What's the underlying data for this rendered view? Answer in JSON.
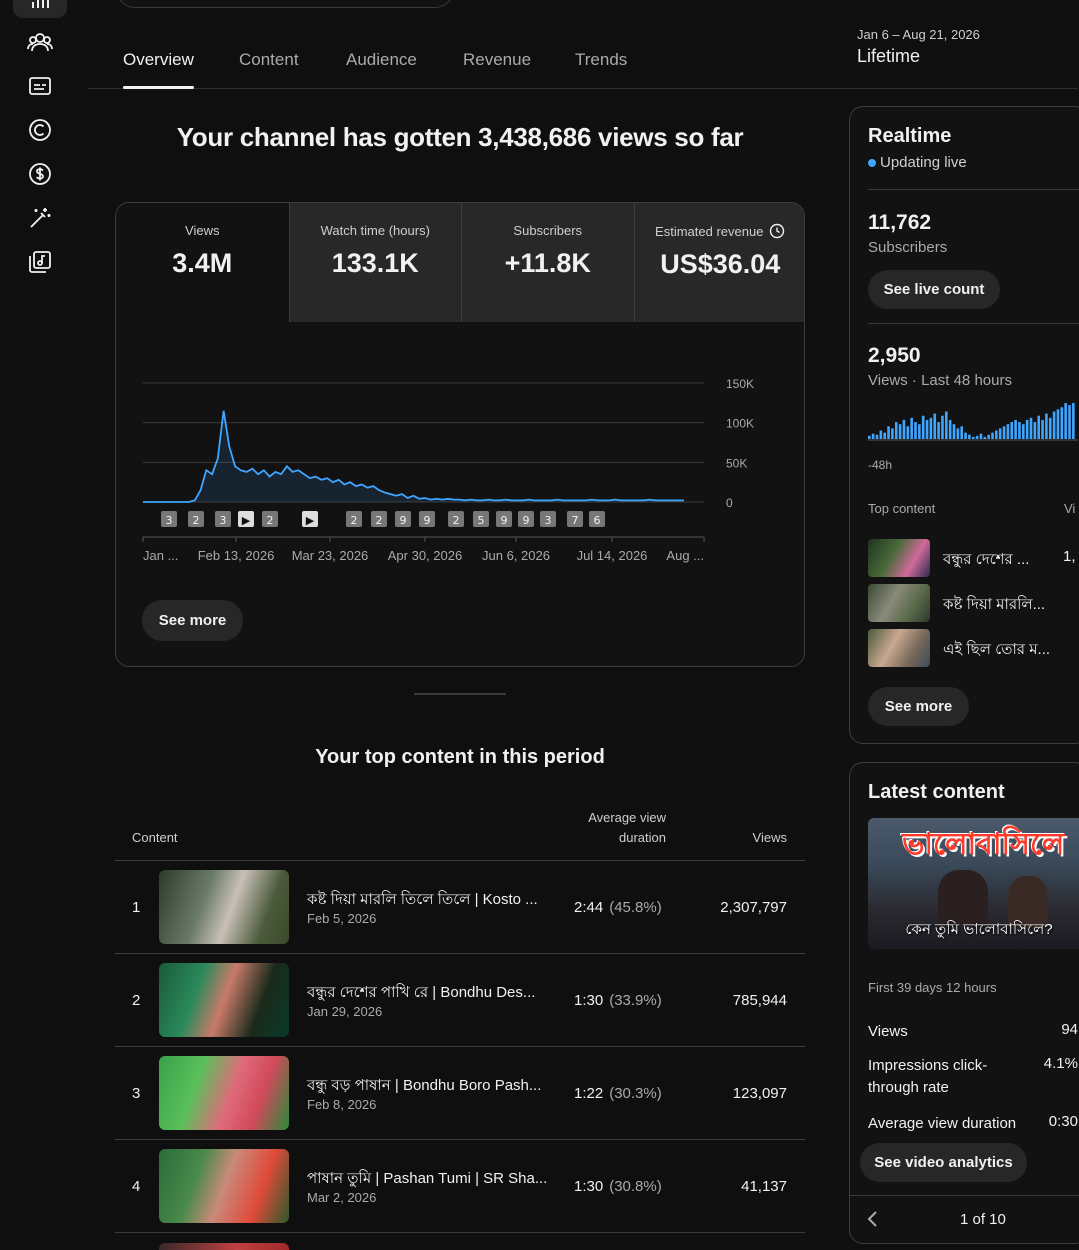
{
  "tabs": [
    {
      "label": "Overview"
    },
    {
      "label": "Content"
    },
    {
      "label": "Audience"
    },
    {
      "label": "Revenue"
    },
    {
      "label": "Trends"
    }
  ],
  "period": {
    "range": "Jan 6 – Aug 21, 2026",
    "label": "Lifetime"
  },
  "headline": "Your channel has gotten 3,438,686 views so far",
  "metrics": [
    {
      "label": "Views",
      "value": "3.4M"
    },
    {
      "label": "Watch time (hours)",
      "value": "133.1K"
    },
    {
      "label": "Subscribers",
      "value": "+11.8K"
    },
    {
      "label": "Estimated revenue",
      "value": "US$36.04"
    }
  ],
  "chart_data": {
    "type": "line",
    "series": [
      {
        "values": [
          0,
          0,
          0,
          0,
          0,
          0,
          0,
          0,
          0,
          2,
          15,
          40,
          35,
          55,
          115,
          70,
          45,
          40,
          38,
          42,
          35,
          40,
          32,
          38,
          35,
          45,
          38,
          40,
          35,
          30,
          32,
          28,
          30,
          25,
          28,
          22,
          25,
          20,
          22,
          18,
          20,
          15,
          12,
          10,
          8,
          10,
          5,
          8,
          4,
          5,
          3,
          4,
          3,
          4,
          3,
          3,
          2,
          3,
          2,
          2,
          3,
          2,
          2,
          3,
          2,
          2,
          2,
          3,
          2,
          2,
          2,
          2,
          3,
          2,
          2,
          2,
          2,
          2,
          3,
          2,
          2,
          2,
          3,
          2,
          2,
          2,
          2,
          2,
          3,
          2,
          2,
          2,
          2,
          2,
          2
        ]
      }
    ],
    "x_labels": [
      "Jan ...",
      "Feb 13, 2026",
      "Mar 23, 2026",
      "Apr 30, 2026",
      "Jun 6, 2026",
      "Jul 14, 2026",
      "Aug ..."
    ],
    "y_ticks": [
      "150K",
      "100K",
      "50K",
      "0"
    ],
    "ylim": [
      0,
      150000
    ],
    "markers": [
      {
        "label": "3"
      },
      {
        "label": "2"
      },
      {
        "label": "3"
      },
      {
        "label": "▶"
      },
      {
        "label": "2"
      },
      {
        "label": "▶"
      },
      {
        "label": "2"
      },
      {
        "label": "2"
      },
      {
        "label": "9"
      },
      {
        "label": "9"
      },
      {
        "label": "2"
      },
      {
        "label": "5"
      },
      {
        "label": "9"
      },
      {
        "label": "9"
      },
      {
        "label": "3"
      },
      {
        "label": "7"
      },
      {
        "label": "6"
      }
    ],
    "colors": {
      "line": "#3ea6ff",
      "grid": "#3a3a3a"
    }
  },
  "see_more_label": "See more",
  "top_content": {
    "title": "Your top content in this period",
    "col_content": "Content",
    "col_avd_line1": "Average view",
    "col_avd_line2": "duration",
    "col_views": "Views",
    "rows": [
      {
        "rank": "1",
        "title": "কষ্ট দিয়া মারলি তিলে তিলে | Kosto ...",
        "date": "Feb 5, 2026",
        "duration": "2:44",
        "pct": "(45.8%)",
        "views": "2,307,797"
      },
      {
        "rank": "2",
        "title": "বন্ধুর দেশের পাখি রে | Bondhu Des...",
        "date": "Jan 29, 2026",
        "duration": "1:30",
        "pct": "(33.9%)",
        "views": "785,944"
      },
      {
        "rank": "3",
        "title": "বন্ধু বড় পাষান | Bondhu Boro Pash...",
        "date": "Feb 8, 2026",
        "duration": "1:22",
        "pct": "(30.3%)",
        "views": "123,097"
      },
      {
        "rank": "4",
        "title": "পাষান তুমি | Pashan Tumi | SR Sha...",
        "date": "Mar 2, 2026",
        "duration": "1:30",
        "pct": "(30.8%)",
        "views": "41,137"
      }
    ]
  },
  "realtime": {
    "title": "Realtime",
    "status": "Updating live",
    "subs_value": "11,762",
    "subs_label": "Subscribers",
    "live_count_btn": "See live count",
    "views_value": "2,950",
    "views_label": "Views · Last 48 hours",
    "axis_left": "-48h",
    "top_content_label": "Top content",
    "views_col_label": "Vi",
    "bars": [
      3,
      5,
      4,
      8,
      6,
      12,
      10,
      16,
      14,
      18,
      12,
      20,
      16,
      14,
      22,
      18,
      20,
      24,
      16,
      22,
      26,
      18,
      14,
      10,
      12,
      6,
      4,
      2,
      3,
      5,
      2,
      4,
      6,
      8,
      10,
      12,
      14,
      16,
      18,
      16,
      14,
      18,
      20,
      16,
      22,
      18,
      24,
      20,
      26,
      28,
      30,
      34,
      32,
      34
    ],
    "items": [
      {
        "name": "বন্ধুর দেশের ...",
        "views": "1,"
      },
      {
        "name": "কষ্ট দিয়া মারলি...",
        "views": ""
      },
      {
        "name": "এই ছিল তোর ম...",
        "views": ""
      }
    ],
    "see_more": "See more"
  },
  "latest": {
    "title": "Latest content",
    "thumb_text_top": "ভালোবাসিলে",
    "thumb_caption": "কেন তুমি ভালোবাসিলে?",
    "period": "First 39 days 12 hours",
    "stats": [
      {
        "label": "Views",
        "value": "94"
      },
      {
        "label": "Impressions click-through rate",
        "value": "4.1%"
      },
      {
        "label": "Average view duration",
        "value": "0:30"
      }
    ],
    "button": "See video analytics",
    "pager": "1 of 10"
  }
}
